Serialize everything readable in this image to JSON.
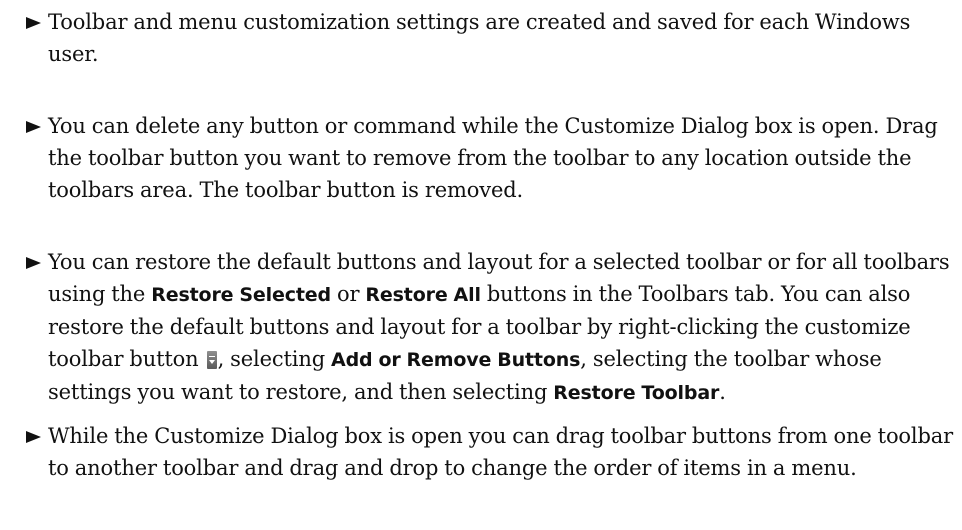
{
  "bullets": [
    {
      "text": "Toolbar and menu customization settings are created and saved for each Windows user."
    },
    {
      "text": "You can delete any button or command while the Customize Dialog box is open. Drag the toolbar button you want to remove from the toolbar to any location outside the toolbars area. The toolbar button is removed."
    },
    {
      "parts": {
        "p1": "You can restore the default buttons and layout for a selected toolbar or for all toolbars using the ",
        "b1": "Restore Selected",
        "p2": " or ",
        "b2": "Restore All",
        "p3": " buttons in the Toolbars tab. You can also restore the default buttons and layout for a toolbar by right-clicking the customize toolbar button ",
        "p4": ", selecting ",
        "b3": "Add or Remove Buttons",
        "p5": ", selecting the toolbar whose settings you want to restore, and then selecting ",
        "b4": "Restore Toolbar",
        "p6": "."
      },
      "icon": "customize-toolbar-icon"
    },
    {
      "text": "While the Customize Dialog box is open you can drag toolbar buttons from one toolbar to another toolbar and drag and drop to change the order of items in a menu."
    }
  ]
}
